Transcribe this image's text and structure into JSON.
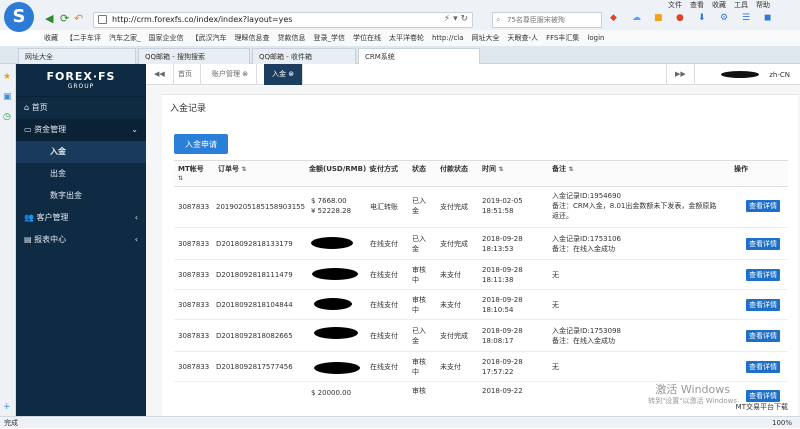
{
  "browser": {
    "menus": [
      "文件",
      "查看",
      "收藏",
      "工具",
      "帮助"
    ],
    "url": "http://crm.forexfs.co/index/index?layout=yes",
    "search_placeholder": "75名尊臣服宋被殉",
    "bookmarks": [
      "收藏",
      "【二手车评",
      "汽车之家_",
      "国家企业信",
      "【武汉汽车",
      "理睬信息查",
      "贷款信息",
      "登录_学信",
      "学位在线",
      "太平洋卷轮",
      "http://cla",
      "网址大全",
      "天眼查-人",
      "FFS丰汇集",
      "login"
    ],
    "tabs": [
      "网址大全",
      "QQ邮箱 - 搜狗搜索",
      "QQ邮箱 - 收件箱",
      "CRM系统"
    ],
    "status": "完成",
    "corner_text": "MT交易平台下载",
    "bottom_right": "100%"
  },
  "app": {
    "brand": "FOREX·FS",
    "brand_sub": "GROUP",
    "menu": {
      "home": "首页",
      "funds": "资金管理",
      "deposit": "入金",
      "withdraw": "出金",
      "digital_withdraw": "数字出金",
      "customers": "客户管理",
      "reports": "报表中心"
    },
    "content_tabs": [
      "首页",
      "账户管理",
      "入金"
    ],
    "lang": "zh-CN"
  },
  "page": {
    "title": "入金记录",
    "add_button": "入金申请",
    "columns": [
      "MT帐号",
      "订单号",
      "金额(USD/RMB)",
      "支付方式",
      "状态",
      "付款状态",
      "时间",
      "备注",
      "操作"
    ],
    "rows": [
      {
        "mt": "3087833",
        "order": "20190205185158903155",
        "amount": "$ 7668.00\n¥ 52228.28",
        "pay": "电汇转账",
        "status": "已入金",
        "paystatus": "支付完成",
        "time": "2019-02-05\n18:51:58",
        "note": "入金记录ID:1954690\n备注：CRM入金，8.01出金数额未下发表，金额原路返还。",
        "action": "查看详情"
      },
      {
        "mt": "3087833",
        "order": "D2018092818133179",
        "amount": "",
        "pay": "在线支付",
        "status": "已入金",
        "paystatus": "支付完成",
        "time": "2018-09-28\n18:13:53",
        "note": "入金记录ID:1753106\n备注：在线入金成功",
        "action": "查看详情"
      },
      {
        "mt": "3087833",
        "order": "D2018092818111479",
        "amount": "",
        "pay": "在线支付",
        "status": "审核中",
        "paystatus": "未支付",
        "time": "2018-09-28\n18:11:38",
        "note": "无",
        "action": "查看详情"
      },
      {
        "mt": "3087833",
        "order": "D2018092818104844",
        "amount": "",
        "pay": "在线支付",
        "status": "审核中",
        "paystatus": "未支付",
        "time": "2018-09-28\n18:10:54",
        "note": "无",
        "action": "查看详情"
      },
      {
        "mt": "3087833",
        "order": "D2018092818082665",
        "amount": "",
        "pay": "在线支付",
        "status": "已入金",
        "paystatus": "支付完成",
        "time": "2018-09-28\n18:08:17",
        "note": "入金记录ID:1753098\n备注：在线入金成功",
        "action": "查看详情"
      },
      {
        "mt": "3087833",
        "order": "D2018092817577456",
        "amount": "",
        "pay": "在线支付",
        "status": "审核中",
        "paystatus": "未支付",
        "time": "2018-09-28\n17:57:22",
        "note": "无",
        "action": "查看详情"
      },
      {
        "mt": "",
        "order": "",
        "amount": "$ 20000.00",
        "pay": "",
        "status": "审核",
        "paystatus": "",
        "time": "2018-09-22",
        "note": "",
        "action": "查看详情"
      }
    ]
  },
  "watermark": {
    "line1": "激活 Windows",
    "line2": "转到\"设置\"以激活 Windows。"
  }
}
